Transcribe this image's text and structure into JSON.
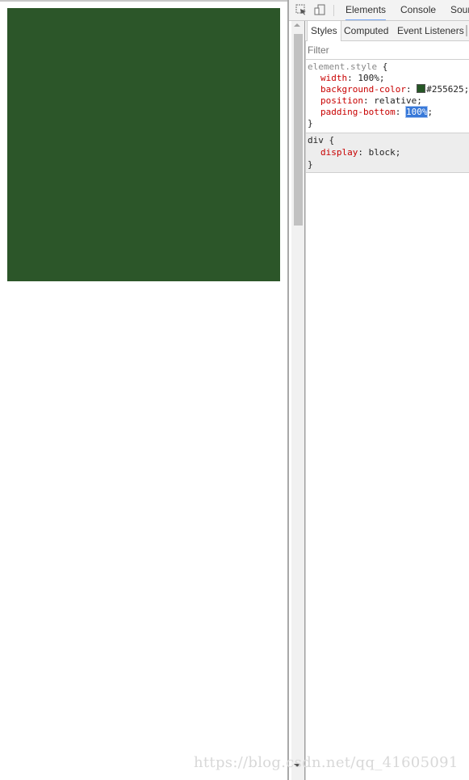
{
  "page": {
    "box_color": "#2c5629"
  },
  "devtools": {
    "toolbar": {
      "inspect_icon": "inspect-element-icon",
      "device_icon": "device-mode-icon",
      "tabs": [
        {
          "label": "Elements",
          "active": true
        },
        {
          "label": "Console",
          "active": false
        },
        {
          "label": "Sour",
          "active": false
        }
      ]
    },
    "sub_tabs": [
      {
        "label": "Styles",
        "active": true
      },
      {
        "label": "Computed",
        "active": false
      },
      {
        "label": "Event Listeners",
        "active": false
      }
    ],
    "filter_placeholder": "Filter",
    "rules": [
      {
        "selector": "element.style",
        "open": "{",
        "close": "}",
        "declarations": [
          {
            "prop": "width",
            "value": "100%;"
          },
          {
            "prop": "background-color",
            "value": "#255625;",
            "swatch": "#255625"
          },
          {
            "prop": "position",
            "value": "relative;"
          },
          {
            "prop": "padding-bottom",
            "value": "100%",
            "suffix": ";",
            "editing": true
          }
        ]
      },
      {
        "selector": "div",
        "open": "{",
        "close": "}",
        "declarations": [
          {
            "prop": "display",
            "value": "block;"
          }
        ]
      }
    ]
  },
  "watermark": "https://blog.csdn.net/qq_41605091"
}
